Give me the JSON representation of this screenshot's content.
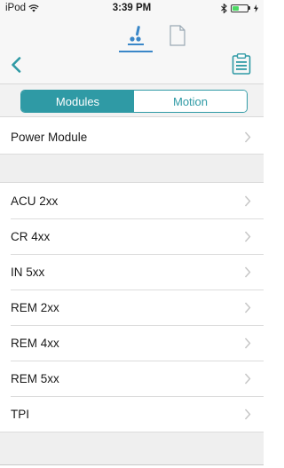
{
  "status_bar": {
    "carrier": "iPod",
    "time": "3:39 PM"
  },
  "top_tabs": [
    {
      "icon": "wheelchair-icon"
    },
    {
      "icon": "document-icon"
    }
  ],
  "nav": {
    "back_icon": "chevron-left-icon",
    "action_icon": "clipboard-icon"
  },
  "segmented": {
    "options": [
      "Modules",
      "Motion"
    ],
    "selected": "Modules"
  },
  "sections": [
    {
      "items": [
        "Power Module"
      ]
    },
    {
      "items": [
        "ACU 2xx",
        "CR 4xx",
        "IN 5xx",
        "REM 2xx",
        "REM 4xx",
        "REM 5xx",
        "TPI"
      ]
    }
  ],
  "colors": {
    "accent": "#2f9aa5",
    "tab_accent": "#3a87c8",
    "battery": "#4cd964"
  }
}
